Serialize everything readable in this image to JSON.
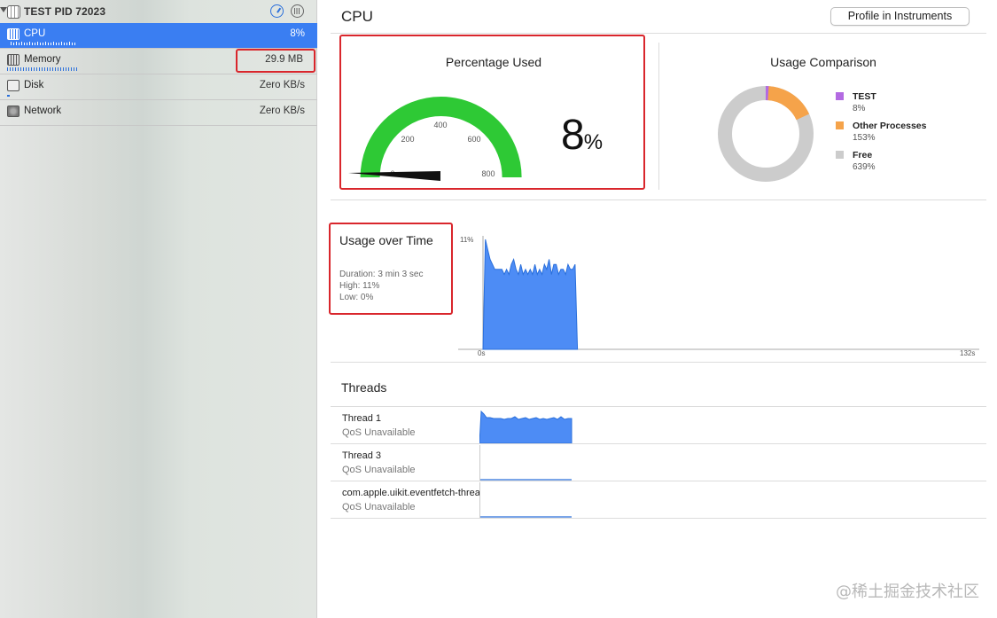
{
  "sidebar": {
    "process_title": "TEST PID 72023",
    "rows": [
      {
        "label": "CPU",
        "value": "8%"
      },
      {
        "label": "Memory",
        "value": "29.9 MB"
      },
      {
        "label": "Disk",
        "value": "Zero KB/s"
      },
      {
        "label": "Network",
        "value": "Zero KB/s"
      }
    ]
  },
  "main": {
    "title": "CPU",
    "profile_button": "Profile in Instruments",
    "percentage_used": {
      "title": "Percentage Used",
      "value": "8",
      "unit": "%",
      "gauge_ticks": [
        "0",
        "200",
        "400",
        "600",
        "800"
      ]
    },
    "usage_comparison": {
      "title": "Usage Comparison",
      "legend": [
        {
          "name": "TEST",
          "value": "8%",
          "color": "#b36ae2"
        },
        {
          "name": "Other Processes",
          "value": "153%",
          "color": "#f5a34a"
        },
        {
          "name": "Free",
          "value": "639%",
          "color": "#cccccc"
        }
      ]
    },
    "usage_over_time": {
      "title": "Usage over Time",
      "duration": "Duration: 3 min 3 sec",
      "high": "High: 11%",
      "low": "Low: 0%",
      "y_label": "11%",
      "x_start": "0s",
      "x_end": "132s"
    },
    "threads": {
      "title": "Threads",
      "items": [
        {
          "name": "Thread 1",
          "qos": "QoS Unavailable"
        },
        {
          "name": "Thread 3",
          "qos": "QoS Unavailable"
        },
        {
          "name": "com.apple.uikit.eventfetch-thread",
          "qos": "QoS Unavailable"
        }
      ]
    }
  },
  "watermark": "@稀土掘金技术社区",
  "colors": {
    "selection": "#3a7ef2",
    "gauge_green": "#2ec935",
    "chart_blue": "#4d8cf5",
    "highlight_red": "#d9262c"
  },
  "chart_data": {
    "type": "area",
    "title": "Usage over Time",
    "ylim": [
      0,
      11
    ],
    "xlim": [
      0,
      132
    ],
    "x_unit": "s",
    "series": [
      {
        "x": [
          0,
          1,
          2,
          3,
          4,
          5,
          6,
          7,
          8,
          9,
          10,
          11,
          12,
          13,
          14,
          15,
          16,
          17,
          18,
          19,
          20,
          21,
          22,
          23,
          24,
          25,
          26,
          27,
          28,
          29,
          30,
          31,
          32,
          33,
          34,
          35,
          36,
          37,
          38,
          39,
          40
        ],
        "y": [
          0,
          11,
          10,
          9,
          8.5,
          8,
          8,
          8,
          8,
          7.5,
          8,
          7.5,
          8.5,
          9,
          8,
          7.5,
          8.5,
          7.5,
          8,
          7.5,
          8,
          7.5,
          8.5,
          7.5,
          8,
          7.5,
          8.5,
          8,
          9,
          7.5,
          8.5,
          8.5,
          7.5,
          8,
          8,
          7.5,
          8.5,
          8,
          8,
          8.5,
          0
        ]
      }
    ]
  }
}
